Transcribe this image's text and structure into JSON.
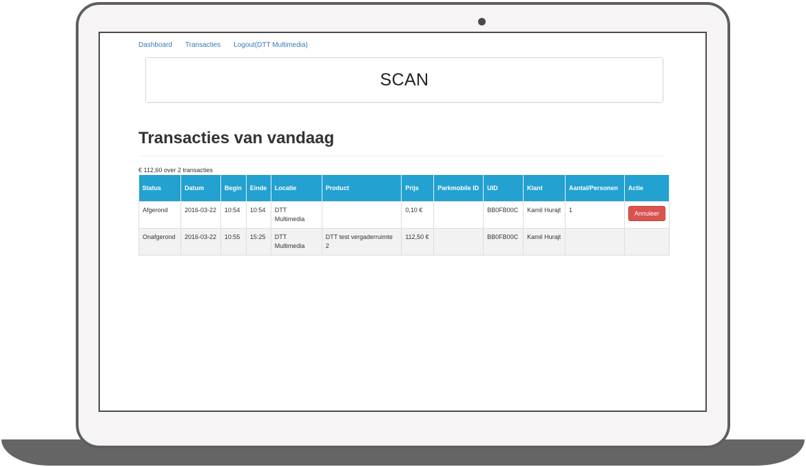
{
  "nav": {
    "items": [
      "Dashboard",
      "Transacties",
      "Logout(DTT Multimedia)"
    ]
  },
  "scan": {
    "label": "SCAN"
  },
  "page": {
    "title": "Transacties van vandaag",
    "summary": "€ 112,60 over 2 transacties"
  },
  "table": {
    "headers": [
      "Status",
      "Datum",
      "Begin",
      "Einde",
      "Locatie",
      "Product",
      "Prijs",
      "Parkmobile ID",
      "UID",
      "Klant",
      "Aantal/Personen",
      "Actie"
    ],
    "rows": [
      {
        "status": "Afgerond",
        "datum": "2016-03-22",
        "begin": "10:54",
        "einde": "10:54",
        "locatie": "DTT Multimedia",
        "product": "",
        "prijs": "0,10 €",
        "parkmobile_id": "",
        "uid": "BB0FB00C",
        "klant": "Kamil Hurajt",
        "aantal": "1",
        "actie": "Annuleer"
      },
      {
        "status": "Onafgerond",
        "datum": "2016-03-22",
        "begin": "10:55",
        "einde": "15:25",
        "locatie": "DTT Multimedia",
        "product": "DTT test vergaderruimte 2",
        "prijs": "112,50 €",
        "parkmobile_id": "",
        "uid": "BB0FB00C",
        "klant": "Kamil Hurajt",
        "aantal": "",
        "actie": ""
      }
    ]
  },
  "colors": {
    "header_bg": "#23a1d1",
    "link": "#337ab7",
    "danger": "#d9534f",
    "frame": "#5e5e5e"
  }
}
